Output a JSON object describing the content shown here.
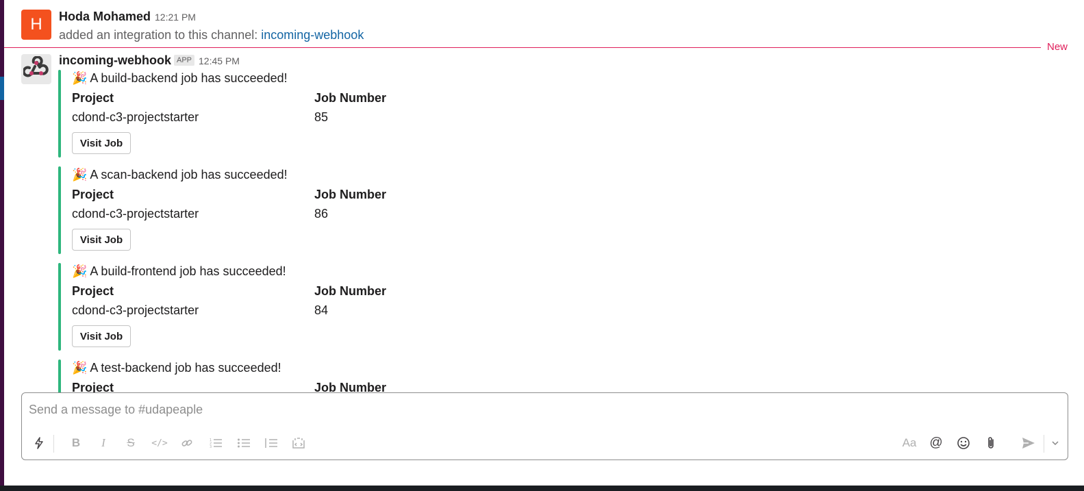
{
  "message1": {
    "avatar_letter": "H",
    "author": "Hoda Mohamed",
    "time": "12:21 PM",
    "text": "added an integration to this channel:",
    "link": "incoming-webhook"
  },
  "divider": {
    "label": "New"
  },
  "message2": {
    "author": "incoming-webhook",
    "badge": "APP",
    "time": "12:45 PM",
    "attachments": [
      {
        "emoji": "🎉",
        "title": "A build-backend job has succeeded!",
        "field1_label": "Project",
        "field1_value": "cdond-c3-projectstarter",
        "field2_label": "Job Number",
        "field2_value": "85",
        "button": "Visit Job"
      },
      {
        "emoji": "🎉",
        "title": "A scan-backend job has succeeded!",
        "field1_label": "Project",
        "field1_value": "cdond-c3-projectstarter",
        "field2_label": "Job Number",
        "field2_value": "86",
        "button": "Visit Job"
      },
      {
        "emoji": "🎉",
        "title": "A build-frontend job has succeeded!",
        "field1_label": "Project",
        "field1_value": "cdond-c3-projectstarter",
        "field2_label": "Job Number",
        "field2_value": "84",
        "button": "Visit Job"
      },
      {
        "emoji": "🎉",
        "title": "A test-backend job has succeeded!",
        "field1_label": "Project",
        "field1_value": "",
        "field2_label": "Job Number",
        "field2_value": "",
        "button": ""
      }
    ]
  },
  "composer": {
    "placeholder": "Send a message to #udapeaple",
    "text_format_label": "Aa",
    "mention_label": "@"
  },
  "colors": {
    "accent_new": "#e01e5a",
    "attachment_bar": "#2eb67d",
    "link": "#1264a3",
    "avatar_h": "#f4511e"
  }
}
